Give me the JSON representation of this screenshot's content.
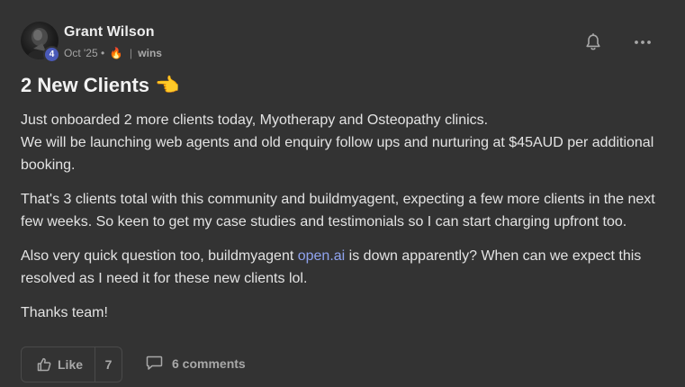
{
  "post": {
    "author": {
      "name": "Grant Wilson",
      "level": "4",
      "avatar_icon": "user-photo"
    },
    "meta": {
      "date": "Oct '25",
      "bullet": "•",
      "fire_emoji": "🔥",
      "separator": "|",
      "category": "wins"
    },
    "actions": {
      "bell_icon": "bell-off-icon",
      "more_icon": "more-horizontal-icon"
    },
    "title": "2 New Clients",
    "title_emoji": "👈",
    "body": {
      "p1_line1": "Just onboarded 2 more clients today, Myotherapy and Osteopathy clinics.",
      "p1_line2": "We will be launching web agents and old enquiry follow ups and nurturing at $45AUD per additional booking.",
      "p2": "That's 3 clients total with this community and buildmyagent, expecting a few more clients in the next few weeks. So keen to get my case studies and testimonials so I can start charging upfront too.",
      "p3_before": "Also very quick question too, buildmyagent ",
      "p3_link": "open.ai",
      "p3_after": " is down apparently? When can we expect this resolved as I need it for these new clients lol.",
      "p4": "Thanks team!"
    },
    "footer": {
      "like_label": "Like",
      "like_count": "7",
      "comments_label": "6 comments"
    }
  },
  "colors": {
    "background": "#333333",
    "badge": "#4a5ab8",
    "link": "#8fa3ef",
    "muted": "#a8a8a8"
  }
}
